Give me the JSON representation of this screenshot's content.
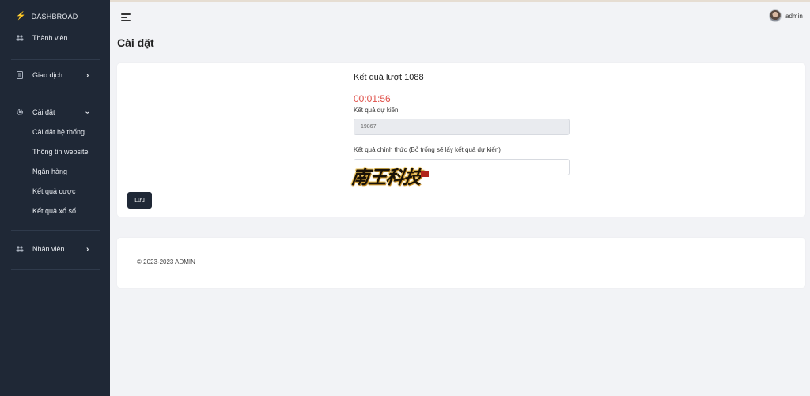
{
  "sidebar": {
    "brand": "DASHBROAD",
    "items": [
      {
        "label": "Thành viên"
      },
      {
        "label": "Giao dịch"
      },
      {
        "label": "Cài đặt"
      },
      {
        "label": "Nhân viên"
      }
    ],
    "settings_sub": [
      {
        "label": "Cài đặt hệ thống"
      },
      {
        "label": "Thông tin website"
      },
      {
        "label": "Ngân hàng"
      },
      {
        "label": "Kết quả cược"
      },
      {
        "label": "Kết quả xổ số"
      }
    ]
  },
  "header": {
    "user": "admin",
    "page_title": "Cài đặt"
  },
  "form": {
    "title": "Kết quả lượt 1088",
    "timer": "00:01:56",
    "predict_label": "Kết quả dự kiến",
    "predict_value": "19867",
    "official_label": "Kết quả chính thức (Bỏ trống sẽ lấy kết quả dự kiến)",
    "official_value": "",
    "save_label": "Lưu"
  },
  "watermark": {
    "text": "南王科技"
  },
  "footer": {
    "copyright": "© 2023-2023 ADMIN"
  },
  "colors": {
    "sidebar_bg": "#1f2836",
    "timer": "#e0524b",
    "brand_bolt": "#f4b400"
  },
  "icons": [
    "bolt-icon",
    "users-icon",
    "receipt-icon",
    "gear-icon",
    "chevron-right-icon",
    "chevron-down-icon",
    "menu-icon"
  ]
}
